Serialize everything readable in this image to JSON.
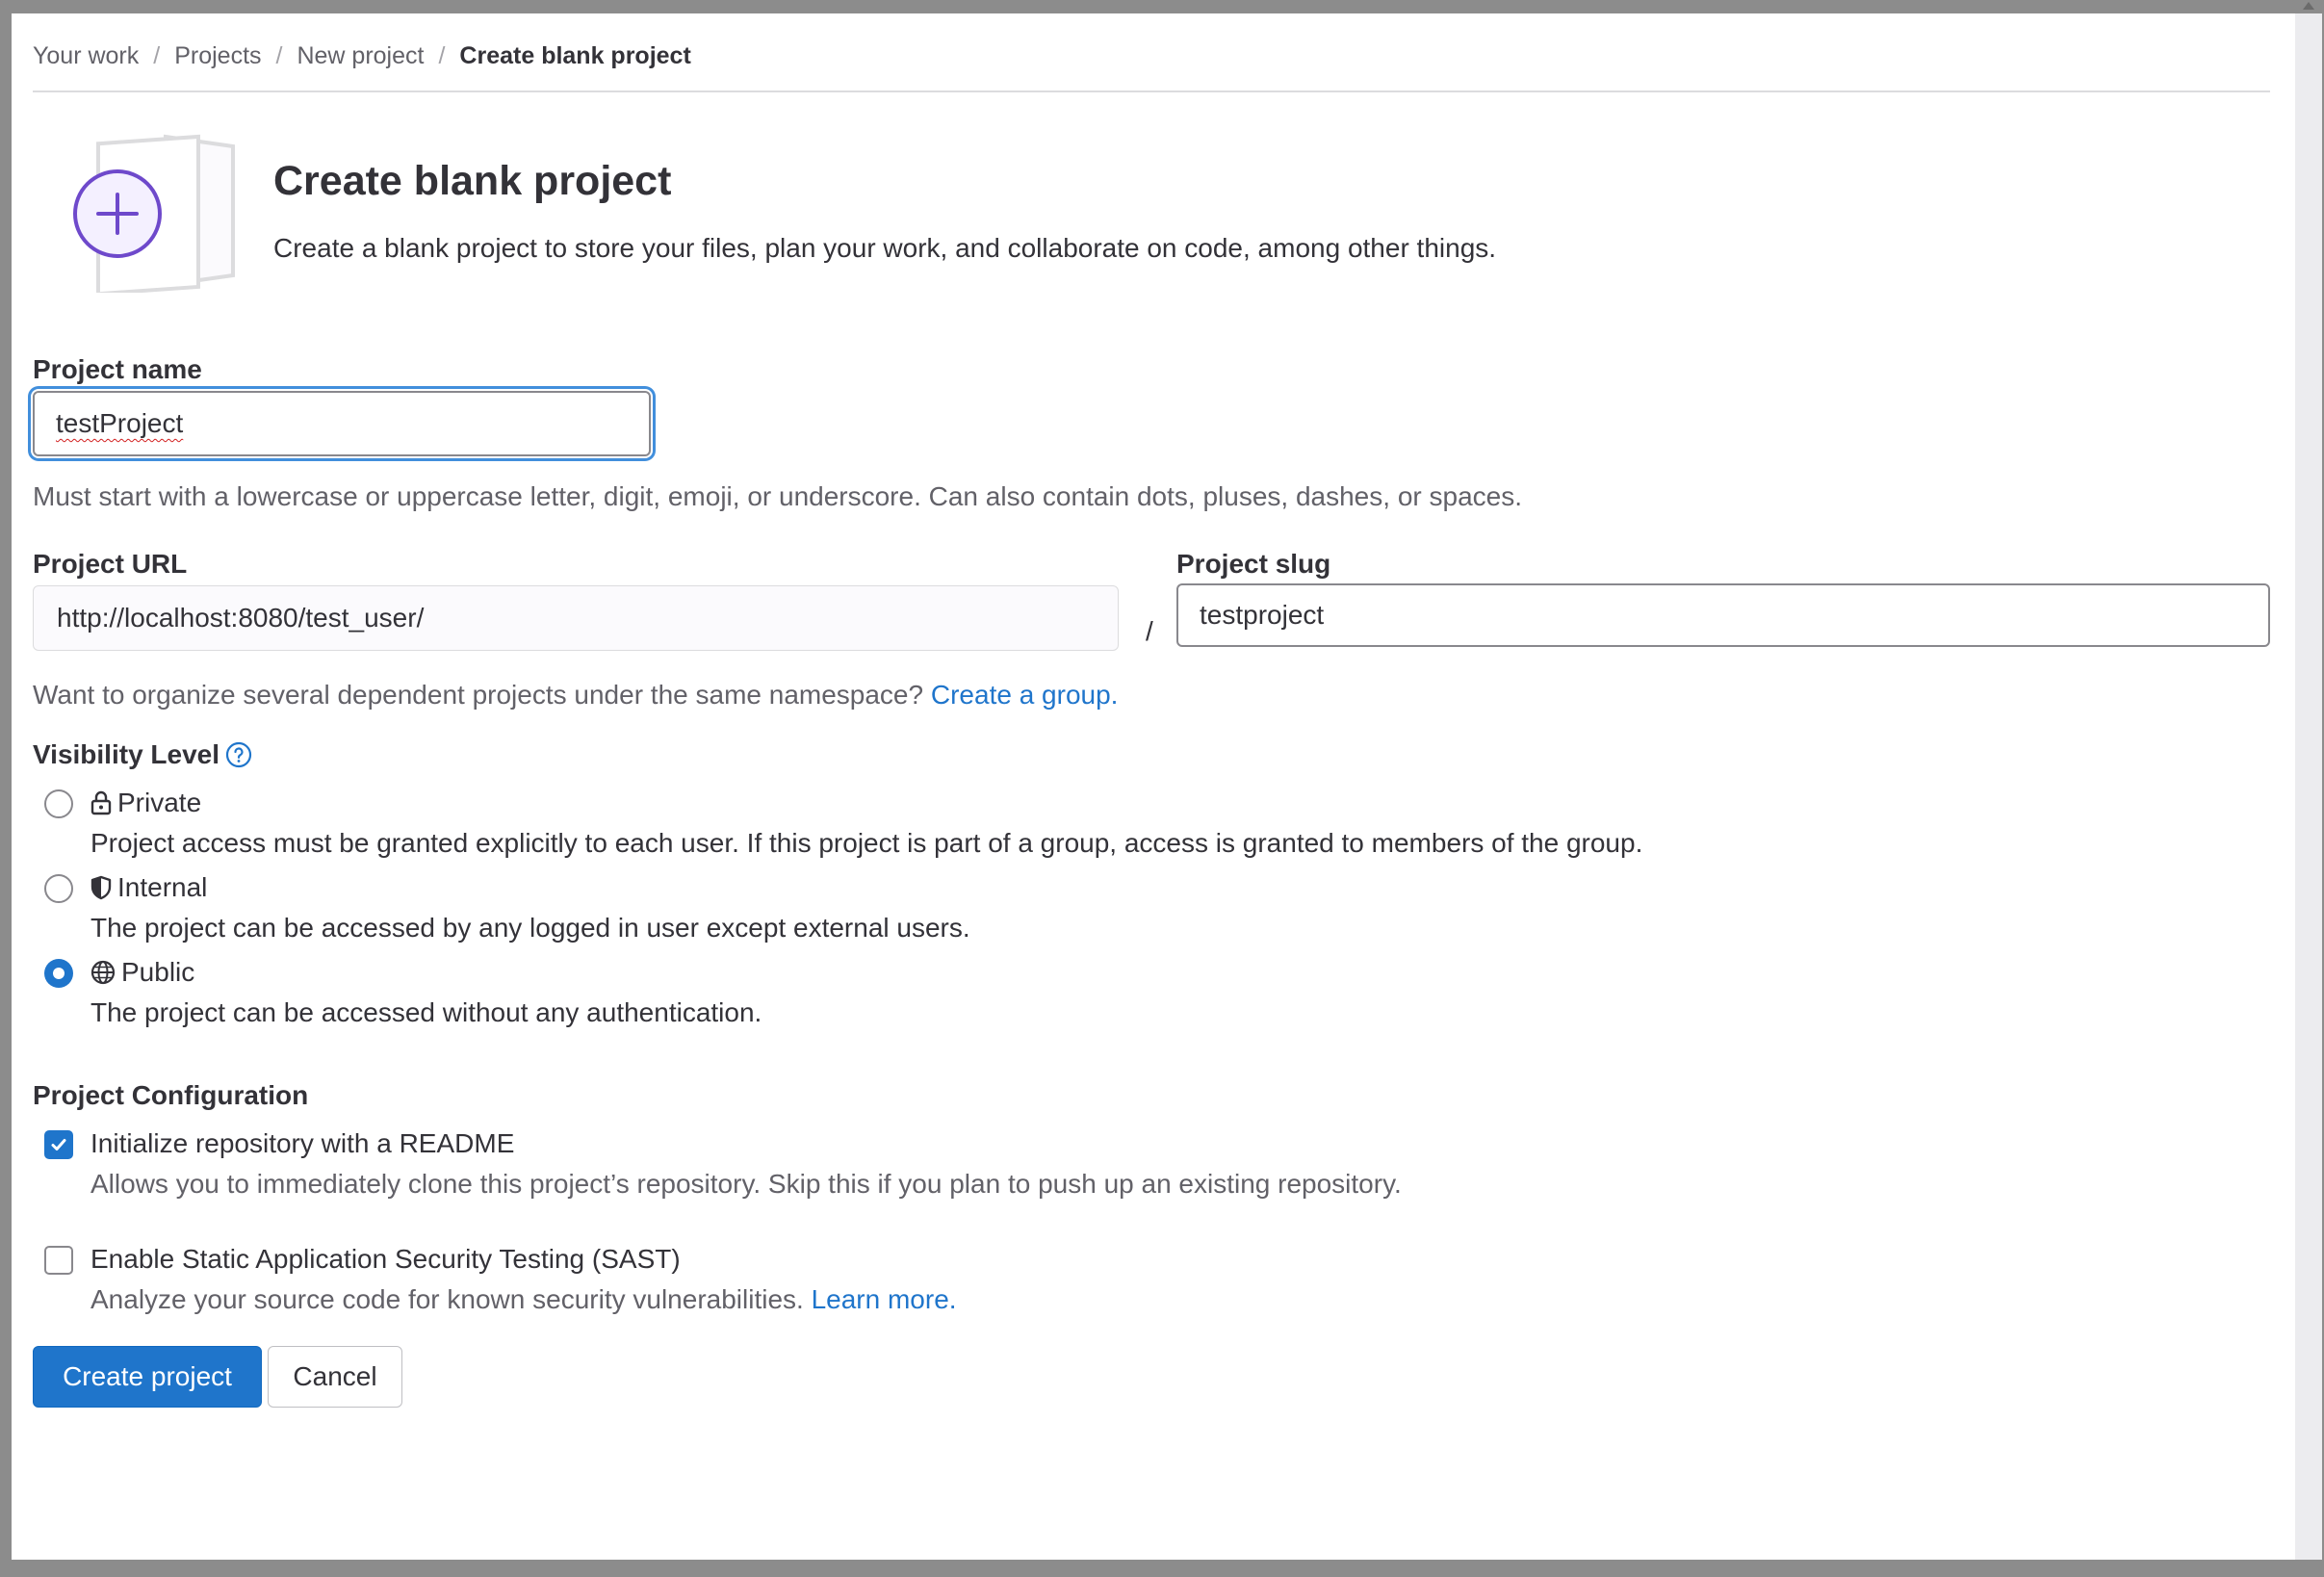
{
  "breadcrumb": {
    "items": [
      "Your work",
      "Projects",
      "New project"
    ],
    "current": "Create blank project",
    "separator": "/"
  },
  "header": {
    "title": "Create blank project",
    "subtitle": "Create a blank project to store your files, plan your work, and collaborate on code, among other things."
  },
  "project_name": {
    "label": "Project name",
    "value": "testProject",
    "help": "Must start with a lowercase or uppercase letter, digit, emoji, or underscore. Can also contain dots, pluses, dashes, or spaces."
  },
  "project_url": {
    "label": "Project URL",
    "value": "http://localhost:8080/test_user/",
    "separator": "/"
  },
  "project_slug": {
    "label": "Project slug",
    "value": "testproject"
  },
  "namespace_help": {
    "text": "Want to organize several dependent projects under the same namespace?",
    "link": "Create a group."
  },
  "visibility": {
    "label": "Visibility Level",
    "help_icon": "question-circle-icon",
    "selected": "Public",
    "options": [
      {
        "title": "Private",
        "icon": "lock-icon",
        "description": "Project access must be granted explicitly to each user. If this project is part of a group, access is granted to members of the group."
      },
      {
        "title": "Internal",
        "icon": "shield-icon",
        "description": "The project can be accessed by any logged in user except external users."
      },
      {
        "title": "Public",
        "icon": "globe-icon",
        "description": "The project can be accessed without any authentication."
      }
    ]
  },
  "configuration": {
    "label": "Project Configuration",
    "readme": {
      "title": "Initialize repository with a README",
      "description": "Allows you to immediately clone this project’s repository. Skip this if you plan to push up an existing repository.",
      "checked": true
    },
    "sast": {
      "title": "Enable Static Application Security Testing (SAST)",
      "description": "Analyze your source code for known security vulnerabilities.",
      "link": "Learn more.",
      "checked": false
    }
  },
  "actions": {
    "create_label": "Create project",
    "cancel_label": "Cancel"
  },
  "colors": {
    "primary": "#1f75cb",
    "link": "#1f75cb",
    "focus_ring": "#428fdc",
    "illustration_accent": "#6e49cb",
    "text": "#333238",
    "muted_text": "#626168"
  }
}
